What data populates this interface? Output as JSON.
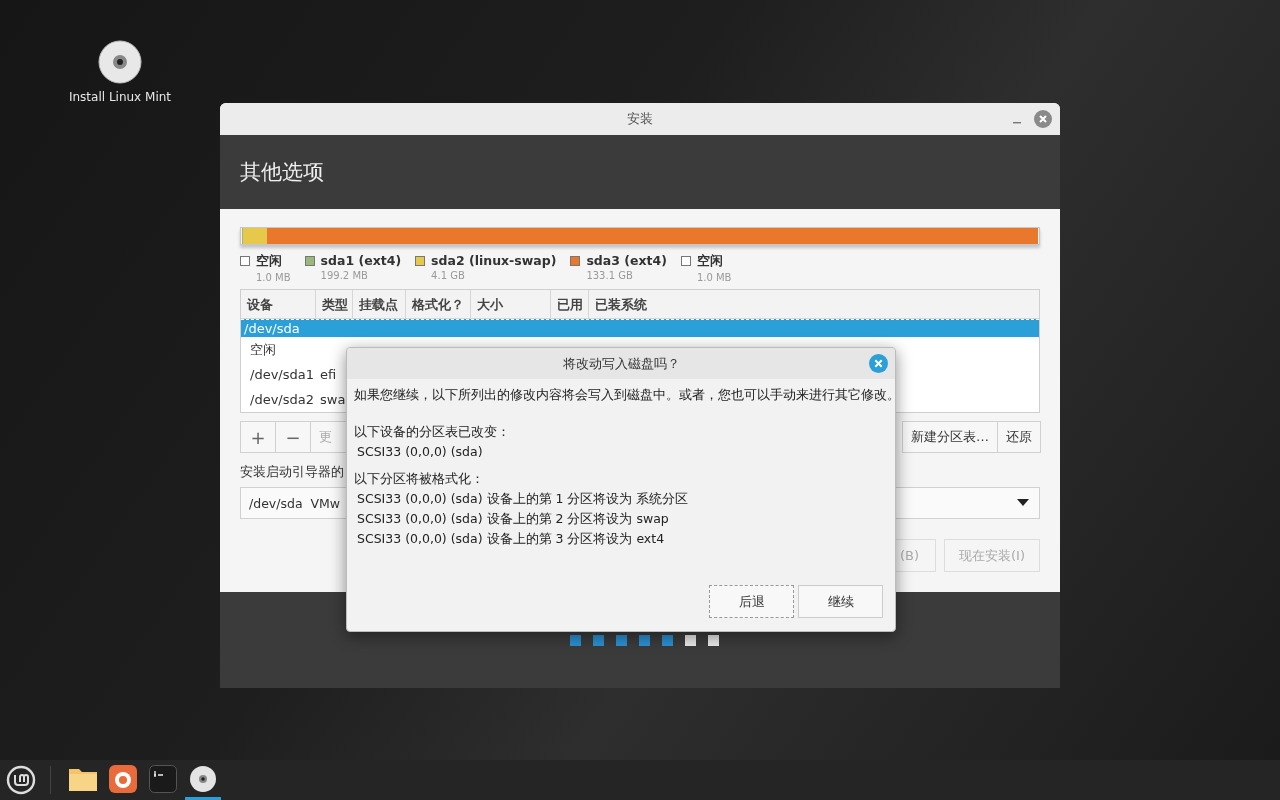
{
  "desktop": {
    "icons": [
      {
        "label": "Install Linux Mint"
      }
    ]
  },
  "window": {
    "title": "安装",
    "heading": "其他选项",
    "legend": [
      {
        "kind": "free",
        "name": "空闲",
        "size": "1.0 MB"
      },
      {
        "kind": "partition",
        "name": "sda1 (ext4)",
        "size": "199.2 MB",
        "color": "#9bb87c"
      },
      {
        "kind": "partition",
        "name": "sda2 (linux-swap)",
        "size": "4.1 GB",
        "color": "#e6c84b"
      },
      {
        "kind": "partition",
        "name": "sda3 (ext4)",
        "size": "133.1 GB",
        "color": "#e9772c"
      },
      {
        "kind": "free",
        "name": "空闲",
        "size": "1.0 MB"
      }
    ],
    "table": {
      "columns": [
        "设备",
        "类型",
        "挂载点",
        "格式化？",
        "大小",
        "已用",
        "已装系统"
      ],
      "rows": [
        {
          "device": "/dev/sda",
          "type": "",
          "selected": true
        },
        {
          "device": "空闲",
          "type": "",
          "selected": false
        },
        {
          "device": "/dev/sda1",
          "type": "efi",
          "selected": false
        },
        {
          "device": "/dev/sda2",
          "type": "swa",
          "selected": false
        }
      ]
    },
    "partition_buttons": {
      "add": "+",
      "remove": "−",
      "change": "更"
    },
    "new_table_button": "新建分区表…",
    "revert_button": "还原",
    "bootloader_label": "安装启动引导器的",
    "bootloader_device": "/dev/sda  VMw",
    "back_button": "(B)",
    "install_button": "现在安装(I)",
    "steps": [
      {
        "done": true
      },
      {
        "done": true
      },
      {
        "done": true
      },
      {
        "done": true
      },
      {
        "done": true
      },
      {
        "done": false
      },
      {
        "done": false
      }
    ]
  },
  "dialog": {
    "title": "将改动写入磁盘吗？",
    "intro": "如果您继续，以下所列出的修改内容将会写入到磁盘中。或者，您也可以手动来进行其它修改。",
    "sections": [
      {
        "heading": "以下设备的分区表已改变：",
        "lines": [
          "SCSI33 (0,0,0) (sda)"
        ]
      },
      {
        "heading": "以下分区将被格式化：",
        "lines": [
          "SCSI33 (0,0,0) (sda) 设备上的第 1 分区将设为 系统分区",
          "SCSI33 (0,0,0) (sda) 设备上的第 2 分区将设为 swap",
          "SCSI33 (0,0,0) (sda) 设备上的第 3 分区将设为 ext4"
        ]
      }
    ],
    "buttons": [
      {
        "label": "后退",
        "focused": true
      },
      {
        "label": "继续",
        "focused": false
      }
    ]
  },
  "taskbar": {
    "apps": [
      {
        "kind": "folder",
        "active": false
      },
      {
        "kind": "browser",
        "active": false
      },
      {
        "kind": "terminal",
        "active": false
      },
      {
        "kind": "disc",
        "active": true
      }
    ]
  }
}
